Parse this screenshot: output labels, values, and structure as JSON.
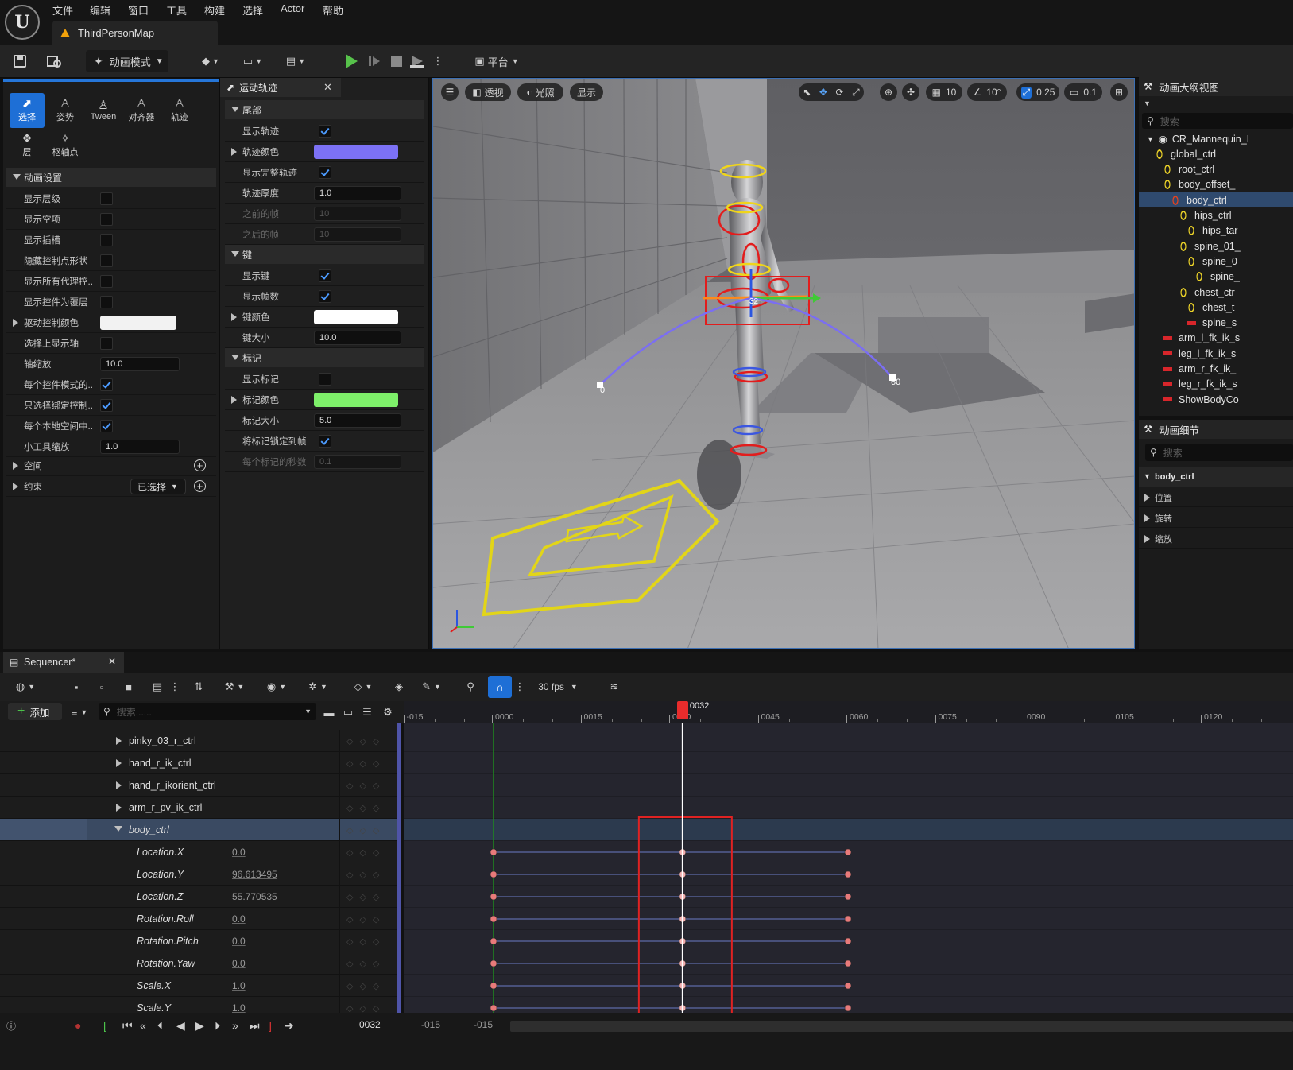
{
  "menu": {
    "items": [
      "文件",
      "编辑",
      "窗口",
      "工具",
      "构建",
      "选择",
      "Actor",
      "帮助"
    ],
    "map_tab": "ThirdPersonMap"
  },
  "toolbar": {
    "mode_label": "动画模式",
    "platform_label": "平台"
  },
  "anim_panel": {
    "modes": [
      "选择",
      "姿势",
      "Tween",
      "对齐器",
      "轨迹",
      "层",
      "枢轴点"
    ],
    "section_title": "动画设置",
    "props": [
      {
        "label": "显示层级",
        "type": "check",
        "value": false
      },
      {
        "label": "显示空项",
        "type": "check",
        "value": false
      },
      {
        "label": "显示插槽",
        "type": "check",
        "value": false
      },
      {
        "label": "隐藏控制点形状",
        "type": "check",
        "value": false
      },
      {
        "label": "显示所有代理控...",
        "type": "check",
        "value": false
      },
      {
        "label": "显示控件为覆层",
        "type": "check",
        "value": false
      },
      {
        "label": "驱动控制颜色",
        "type": "color",
        "value": "#f2f2f2"
      },
      {
        "label": "选择上显示轴",
        "type": "check",
        "value": false
      },
      {
        "label": "轴缩放",
        "type": "num",
        "value": "10.0"
      },
      {
        "label": "每个控件模式的...",
        "type": "check",
        "value": true
      },
      {
        "label": "只选择绑定控制...",
        "type": "check",
        "value": true
      },
      {
        "label": "每个本地空间中...",
        "type": "check",
        "value": true
      },
      {
        "label": "小工具缩放",
        "type": "num",
        "value": "1.0"
      }
    ],
    "space_label": "空间",
    "constraint_label": "约束",
    "selected_dropdown": "已选择"
  },
  "trail_panel": {
    "tab_title": "运动轨迹",
    "sections": [
      {
        "title": "尾部",
        "props": [
          {
            "label": "显示轨迹",
            "type": "check",
            "value": true
          },
          {
            "label": "轨迹颜色",
            "type": "color",
            "value": "#7c71f5",
            "expand": true
          },
          {
            "label": "显示完整轨迹",
            "type": "check",
            "value": true
          },
          {
            "label": "轨迹厚度",
            "type": "num",
            "value": "1.0"
          },
          {
            "label": "之前的帧",
            "type": "numdim",
            "value": "10"
          },
          {
            "label": "之后的帧",
            "type": "numdim",
            "value": "10"
          }
        ]
      },
      {
        "title": "键",
        "props": [
          {
            "label": "显示键",
            "type": "check",
            "value": true
          },
          {
            "label": "显示帧数",
            "type": "check",
            "value": true
          },
          {
            "label": "键颜色",
            "type": "color",
            "value": "#ffffff",
            "expand": true
          },
          {
            "label": "键大小",
            "type": "num",
            "value": "10.0"
          }
        ]
      },
      {
        "title": "标记",
        "props": [
          {
            "label": "显示标记",
            "type": "check",
            "value": false
          },
          {
            "label": "标记颜色",
            "type": "color",
            "value": "#7ef06a",
            "expand": true
          },
          {
            "label": "标记大小",
            "type": "num",
            "value": "5.0"
          },
          {
            "label": "将标记锁定到帧",
            "type": "check",
            "value": true
          },
          {
            "label": "每个标记的秒数",
            "type": "numdim",
            "value": "0.1",
            "dim": true
          }
        ]
      }
    ]
  },
  "viewport": {
    "perspective": "透视",
    "lighting": "光照",
    "show": "显示",
    "grid_snap": "10",
    "angle_snap": "10°",
    "scale_snap": "0.25",
    "camera_speed": "0.1",
    "trail_labels": [
      "0",
      "32",
      "60"
    ]
  },
  "outliner": {
    "title": "动画大纲视图",
    "search_placeholder": "搜索",
    "items": [
      {
        "label": "CR_Mannequin_I",
        "kind": "root",
        "indent": 0
      },
      {
        "label": "global_ctrl",
        "kind": "ring",
        "indent": 1
      },
      {
        "label": "root_ctrl",
        "kind": "ring",
        "indent": 2
      },
      {
        "label": "body_offset_",
        "kind": "ring",
        "indent": 2
      },
      {
        "label": "body_ctrl",
        "kind": "ring-red",
        "indent": 3,
        "selected": true
      },
      {
        "label": "hips_ctrl",
        "kind": "ring",
        "indent": 4
      },
      {
        "label": "hips_tar",
        "kind": "ring",
        "indent": 5
      },
      {
        "label": "spine_01_",
        "kind": "ring",
        "indent": 4
      },
      {
        "label": "spine_0",
        "kind": "ring",
        "indent": 5
      },
      {
        "label": "spine_",
        "kind": "ring",
        "indent": 6
      },
      {
        "label": "chest_ctr",
        "kind": "ring",
        "indent": 4
      },
      {
        "label": "chest_t",
        "kind": "ring",
        "indent": 5
      },
      {
        "label": "spine_s",
        "kind": "bar",
        "indent": 5
      },
      {
        "label": "arm_l_fk_ik_s",
        "kind": "bar",
        "indent": 2
      },
      {
        "label": "leg_l_fk_ik_s",
        "kind": "bar",
        "indent": 2
      },
      {
        "label": "arm_r_fk_ik_",
        "kind": "bar",
        "indent": 2
      },
      {
        "label": "leg_r_fk_ik_s",
        "kind": "bar",
        "indent": 2
      },
      {
        "label": "ShowBodyCo",
        "kind": "bar",
        "indent": 2
      }
    ]
  },
  "details": {
    "title": "动画细节",
    "search_placeholder": "搜索",
    "object": "body_ctrl",
    "sections": [
      "位置",
      "旋转",
      "缩放"
    ]
  },
  "sequencer": {
    "tab_title": "Sequencer*",
    "fps": "30 fps",
    "add_label": "添加",
    "search_placeholder": "搜索......",
    "current_frame": "0032",
    "ruler_ticks": [
      "-015",
      "0000",
      "0015",
      "0030",
      "0045",
      "0060",
      "0075",
      "0090",
      "0105",
      "0120"
    ],
    "tracks": [
      {
        "name": "pinky_03_r_ctrl",
        "kind": "collapsed"
      },
      {
        "name": "hand_r_ik_ctrl",
        "kind": "collapsed"
      },
      {
        "name": "hand_r_ikorient_ctrl",
        "kind": "collapsed"
      },
      {
        "name": "arm_r_pv_ik_ctrl",
        "kind": "collapsed"
      },
      {
        "name": "body_ctrl",
        "kind": "expanded"
      },
      {
        "name": "Location.X",
        "kind": "channel",
        "value": "0.0"
      },
      {
        "name": "Location.Y",
        "kind": "channel",
        "value": "96.613495"
      },
      {
        "name": "Location.Z",
        "kind": "channel",
        "value": "55.770535"
      },
      {
        "name": "Rotation.Roll",
        "kind": "channel",
        "value": "0.0"
      },
      {
        "name": "Rotation.Pitch",
        "kind": "channel",
        "value": "0.0"
      },
      {
        "name": "Rotation.Yaw",
        "kind": "channel",
        "value": "0.0"
      },
      {
        "name": "Scale.X",
        "kind": "channel",
        "value": "1.0"
      },
      {
        "name": "Scale.Y",
        "kind": "channel",
        "value": "1.0"
      }
    ],
    "key_frames": [
      0,
      32,
      60
    ],
    "transport_frame": "0032",
    "range_start": "-015",
    "range_end": "-015"
  }
}
